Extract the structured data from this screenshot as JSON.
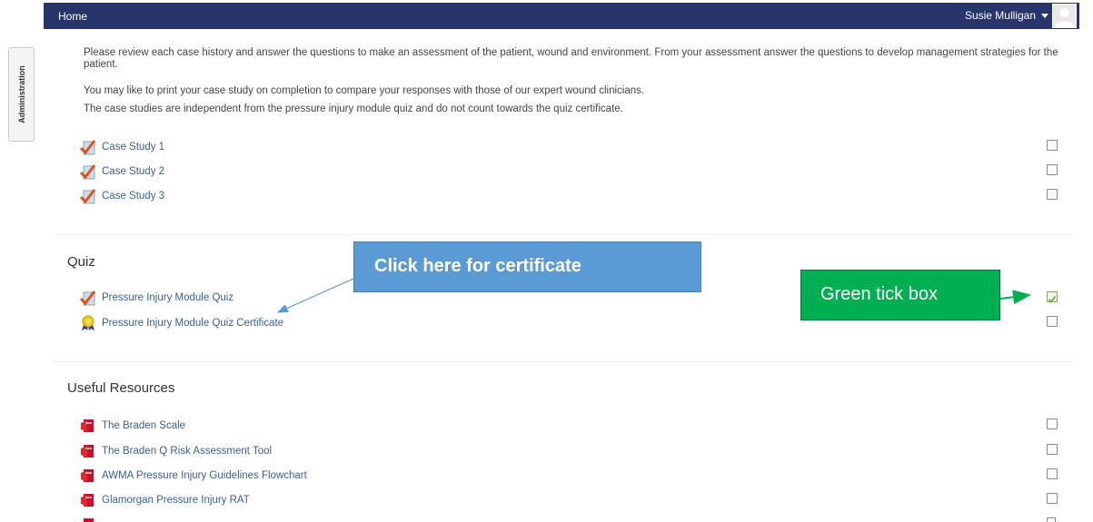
{
  "topbar": {
    "home": "Home",
    "user_name": "Susie Mulligan"
  },
  "side": {
    "admin_tab": "Administration"
  },
  "intro": {
    "p1": "Please review each case history and answer the questions to make an assessment of the patient, wound and environment. From your assessment answer the questions to develop management strategies for the patient.",
    "p2": "You may like to print your case study on completion to compare your responses with those of our expert wound clinicians.",
    "p3": "The case studies are independent from the pressure injury module quiz and do not count towards the quiz certificate."
  },
  "case_studies": [
    {
      "label": "Case Study 1",
      "icon": "quiz-icon",
      "completed": false
    },
    {
      "label": "Case Study 2",
      "icon": "quiz-icon",
      "completed": false
    },
    {
      "label": "Case Study 3",
      "icon": "quiz-icon",
      "completed": false
    }
  ],
  "quiz": {
    "title": "Quiz",
    "items": [
      {
        "label": "Pressure Injury Module Quiz",
        "icon": "quiz-icon",
        "completed": true
      },
      {
        "label": "Pressure Injury Module Quiz Certificate",
        "icon": "certificate-icon",
        "completed": false
      }
    ]
  },
  "resources": {
    "title": "Useful Resources",
    "items": [
      {
        "label": "The Braden Scale",
        "icon": "pdf-icon",
        "completed": false
      },
      {
        "label": "The Braden Q Risk Assessment Tool",
        "icon": "pdf-icon",
        "completed": false
      },
      {
        "label": "AWMA Pressure Injury Guidelines Flowchart",
        "icon": "pdf-icon",
        "completed": false
      },
      {
        "label": "Glamorgan Pressure Injury RAT",
        "icon": "pdf-icon",
        "completed": false
      }
    ]
  },
  "annotations": {
    "certificate_callout": "Click here for certificate",
    "tickbox_callout": "Green tick box"
  },
  "colors": {
    "navbar": "#27356b",
    "link": "#3a5f92",
    "callout_blue": "#5b9bd5",
    "callout_green": "#00b050"
  }
}
